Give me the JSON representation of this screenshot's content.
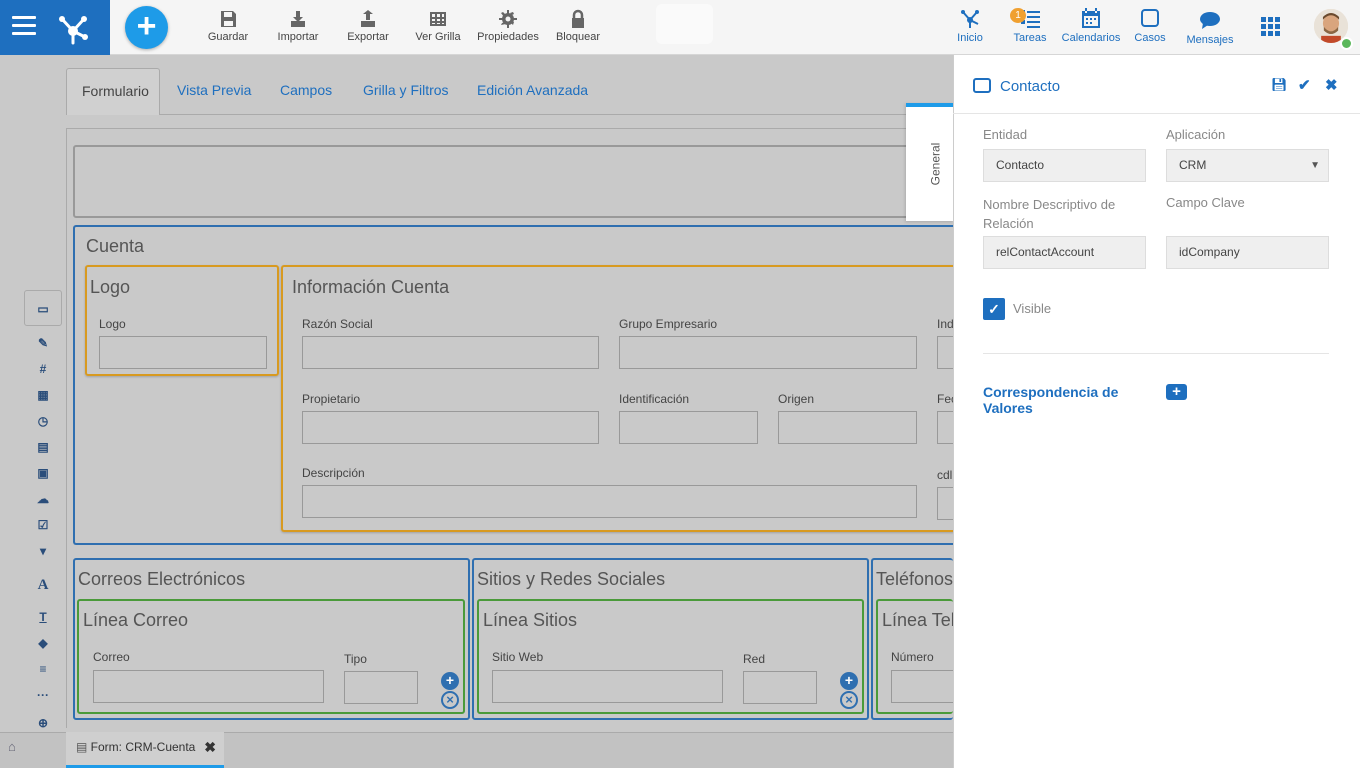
{
  "toolbar": {
    "guardar": "Guardar",
    "importar": "Importar",
    "exportar": "Exportar",
    "ver_grilla": "Ver Grilla",
    "propiedades": "Propiedades",
    "bloquear": "Bloquear"
  },
  "nav": {
    "inicio": "Inicio",
    "tareas": "Tareas",
    "tareas_badge": "1",
    "calendarios": "Calendarios",
    "casos": "Casos",
    "mensajes": "Mensajes"
  },
  "tabs": [
    "Formulario",
    "Vista Previa",
    "Campos",
    "Grilla y Filtros",
    "Edición Avanzada"
  ],
  "form": {
    "cuenta_title": "Cuenta",
    "logo_group": "Logo",
    "logo_label": "Logo",
    "info_group": "Información Cuenta",
    "razon_social": "Razón Social",
    "grupo_empresario": "Grupo Empresario",
    "ind": "Ind",
    "propietario": "Propietario",
    "identificacion": "Identificación",
    "origen": "Origen",
    "fec": "Fec",
    "descripcion": "Descripción",
    "cdl": "cdl",
    "correos_title": "Correos Electrónicos",
    "linea_correo": "Línea Correo",
    "correo": "Correo",
    "tipo": "Tipo",
    "sitios_title": "Sitios y Redes Sociales",
    "linea_sitios": "Línea Sitios",
    "sitio_web": "Sitio Web",
    "red": "Red",
    "telefonos_title": "Teléfonos",
    "linea_tel": "Línea Tel",
    "numero": "Número"
  },
  "bottom": {
    "form_tab": "Form: CRM-Cuenta"
  },
  "panel": {
    "side_tab": "General",
    "title": "Contacto",
    "entidad_label": "Entidad",
    "entidad_value": "Contacto",
    "aplicacion_label": "Aplicación",
    "aplicacion_value": "CRM",
    "nombre_rel_label": "Nombre Descriptivo de Relación",
    "nombre_rel_value": "relContactAccount",
    "campo_clave_label": "Campo Clave",
    "campo_clave_value": "idCompany",
    "visible_label": "Visible",
    "visible_checked": true,
    "correspondencia_label": "Correspondencia de Valores"
  },
  "colors": {
    "brand": "#1e6fbf",
    "accent": "#1e9be8",
    "section_border": "#2f6fb0",
    "group_orange": "#d89a20",
    "group_green": "#4a9a3a"
  }
}
